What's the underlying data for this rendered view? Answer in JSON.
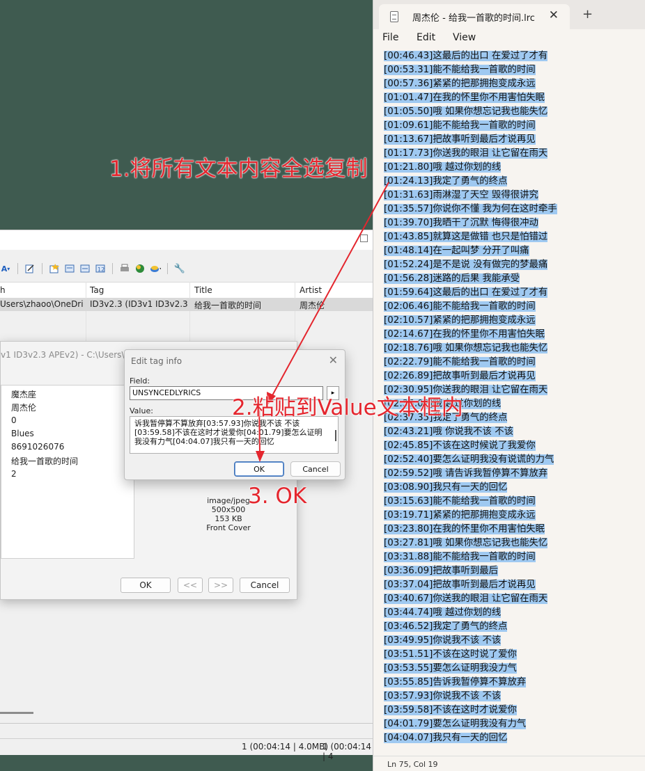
{
  "player": {
    "toolbar_icons": [
      "text-format-icon",
      "edit-icon",
      "tag-add-icon",
      "tag-icon",
      "tag-copy-icon",
      "tag-paste-icon",
      "print-icon",
      "web-globe-icon",
      "web-dropdown-icon",
      "wrench-icon"
    ],
    "columns": {
      "path": "h",
      "tag": "Tag",
      "title": "Title",
      "artist": "Artist"
    },
    "row": {
      "path": "Users\\zhaoo\\OneDri...",
      "tag": "ID3v2.3 (ID3v1 ID3v2.3 A...",
      "title": "给我一首歌的时间",
      "artist": "周杰伦"
    },
    "status_left": "1 (00:04:14 | 4.0MB)",
    "status_right": "1 (00:04:14 | 4"
  },
  "properties": {
    "title": "v1 ID3v2.3 APEv2) - C:\\Users\\zha...\\周杰伦 - 给我一首歌的时间.mp3",
    "values": [
      "魔杰座",
      "周杰伦",
      "0",
      "Blues",
      "8691026076",
      "给我一首歌的时间",
      "2"
    ],
    "art": {
      "type": "image/jpeg",
      "size": "500x500",
      "bytes": "153 KB",
      "kind": "Front Cover"
    },
    "buttons": {
      "ok": "OK",
      "prev": "<<",
      "next": ">>",
      "cancel": "Cancel"
    }
  },
  "edit_dialog": {
    "title": "Edit tag info",
    "field_label": "Field:",
    "field_value": "UNSYNCEDLYRICS",
    "value_label": "Value:",
    "value_text": "诉我暂停算不算放弃[03:57.93]你说我不该 不该[03:59.58]不该在这时才说爱你[04:01.79]要怎么证明我没有力气[04:04.07]我只有一天的回忆",
    "ok": "OK",
    "cancel": "Cancel"
  },
  "notepad": {
    "tab_title": "周杰伦 - 给我一首歌的时间.lrc",
    "menu": {
      "file": "File",
      "edit": "Edit",
      "view": "View"
    },
    "status": "Ln 75, Col 19",
    "lines": [
      "[00:46.43]这最后的出口 在爱过了才有",
      "[00:53.31]能不能给我一首歌的时间",
      "[00:57.36]紧紧的把那拥抱变成永远",
      "[01:01.47]在我的怀里你不用害怕失眠",
      "[01:05.50]哦 如果你想忘记我也能失忆",
      "[01:09.61]能不能给我一首歌的时间",
      "[01:13.67]把故事听到最后才说再见",
      "[01:17.73]你送我的眼泪 让它留在雨天",
      "[01:21.80]哦 越过你划的线",
      "[01:24.13]我定了勇气的终点",
      "[01:31.63]雨淋湿了天空 毁得很讲究",
      "[01:35.57]你说你不懂 我为何在这时牵手",
      "[01:39.70]我晒干了沉默 悔得很冲动",
      "[01:43.85]就算这是做错 也只是怕错过",
      "[01:48.14]在一起叫梦 分开了叫痛",
      "[01:52.24]是不是说 没有做完的梦最痛",
      "[01:56.28]迷路的后果 我能承受",
      "[01:59.64]这最后的出口 在爱过了才有",
      "[02:06.46]能不能给我一首歌的时间",
      "[02:10.57]紧紧的把那拥抱变成永远",
      "[02:14.67]在我的怀里你不用害怕失眠",
      "[02:18.76]哦 如果你想忘记我也能失忆",
      "[02:22.79]能不能给我一首歌的时间",
      "[02:26.89]把故事听到最后才说再见",
      "[02:30.95]你送我的眼泪 让它留在雨天",
      "[02:35.02]哦 越过你划的线",
      "[02:37.35]我定了勇气的终点",
      "[02:43.21]哦 你说我不该 不该",
      "[02:45.85]不该在这时候说了我爱你",
      "[02:52.40]要怎么证明我没有说谎的力气",
      "[02:59.52]哦 请告诉我暂停算不算放弃",
      "[03:08.90]我只有一天的回忆",
      "[03:15.63]能不能给我一首歌的时间",
      "[03:19.71]紧紧的把那拥抱变成永远",
      "[03:23.80]在我的怀里你不用害怕失眠",
      "[03:27.81]哦 如果你想忘记我也能失忆",
      "[03:31.88]能不能给我一首歌的时间",
      "[03:36.09]把故事听到最后",
      "[03:37.04]把故事听到最后才说再见",
      "[03:40.67]你送我的眼泪 让它留在雨天",
      "[03:44.74]哦 越过你划的线",
      "[03:46.52]我定了勇气的终点",
      "[03:49.95]你说我不该 不该",
      "[03:51.51]不该在这时说了爱你",
      "[03:53.55]要怎么证明我没力气",
      "[03:55.85]告诉我暂停算不算放弃",
      "[03:57.93]你说我不该 不该",
      "[03:59.58]不该在这时才说爱你",
      "[04:01.79]要怎么证明我没有力气",
      "[04:04.07]我只有一天的回忆"
    ]
  },
  "annotations": {
    "step1": "1.将所有文本内容全选复制",
    "step2": "2.粘贴到Value文本框内",
    "step3": "3. OK",
    "color": "#e4262e"
  }
}
